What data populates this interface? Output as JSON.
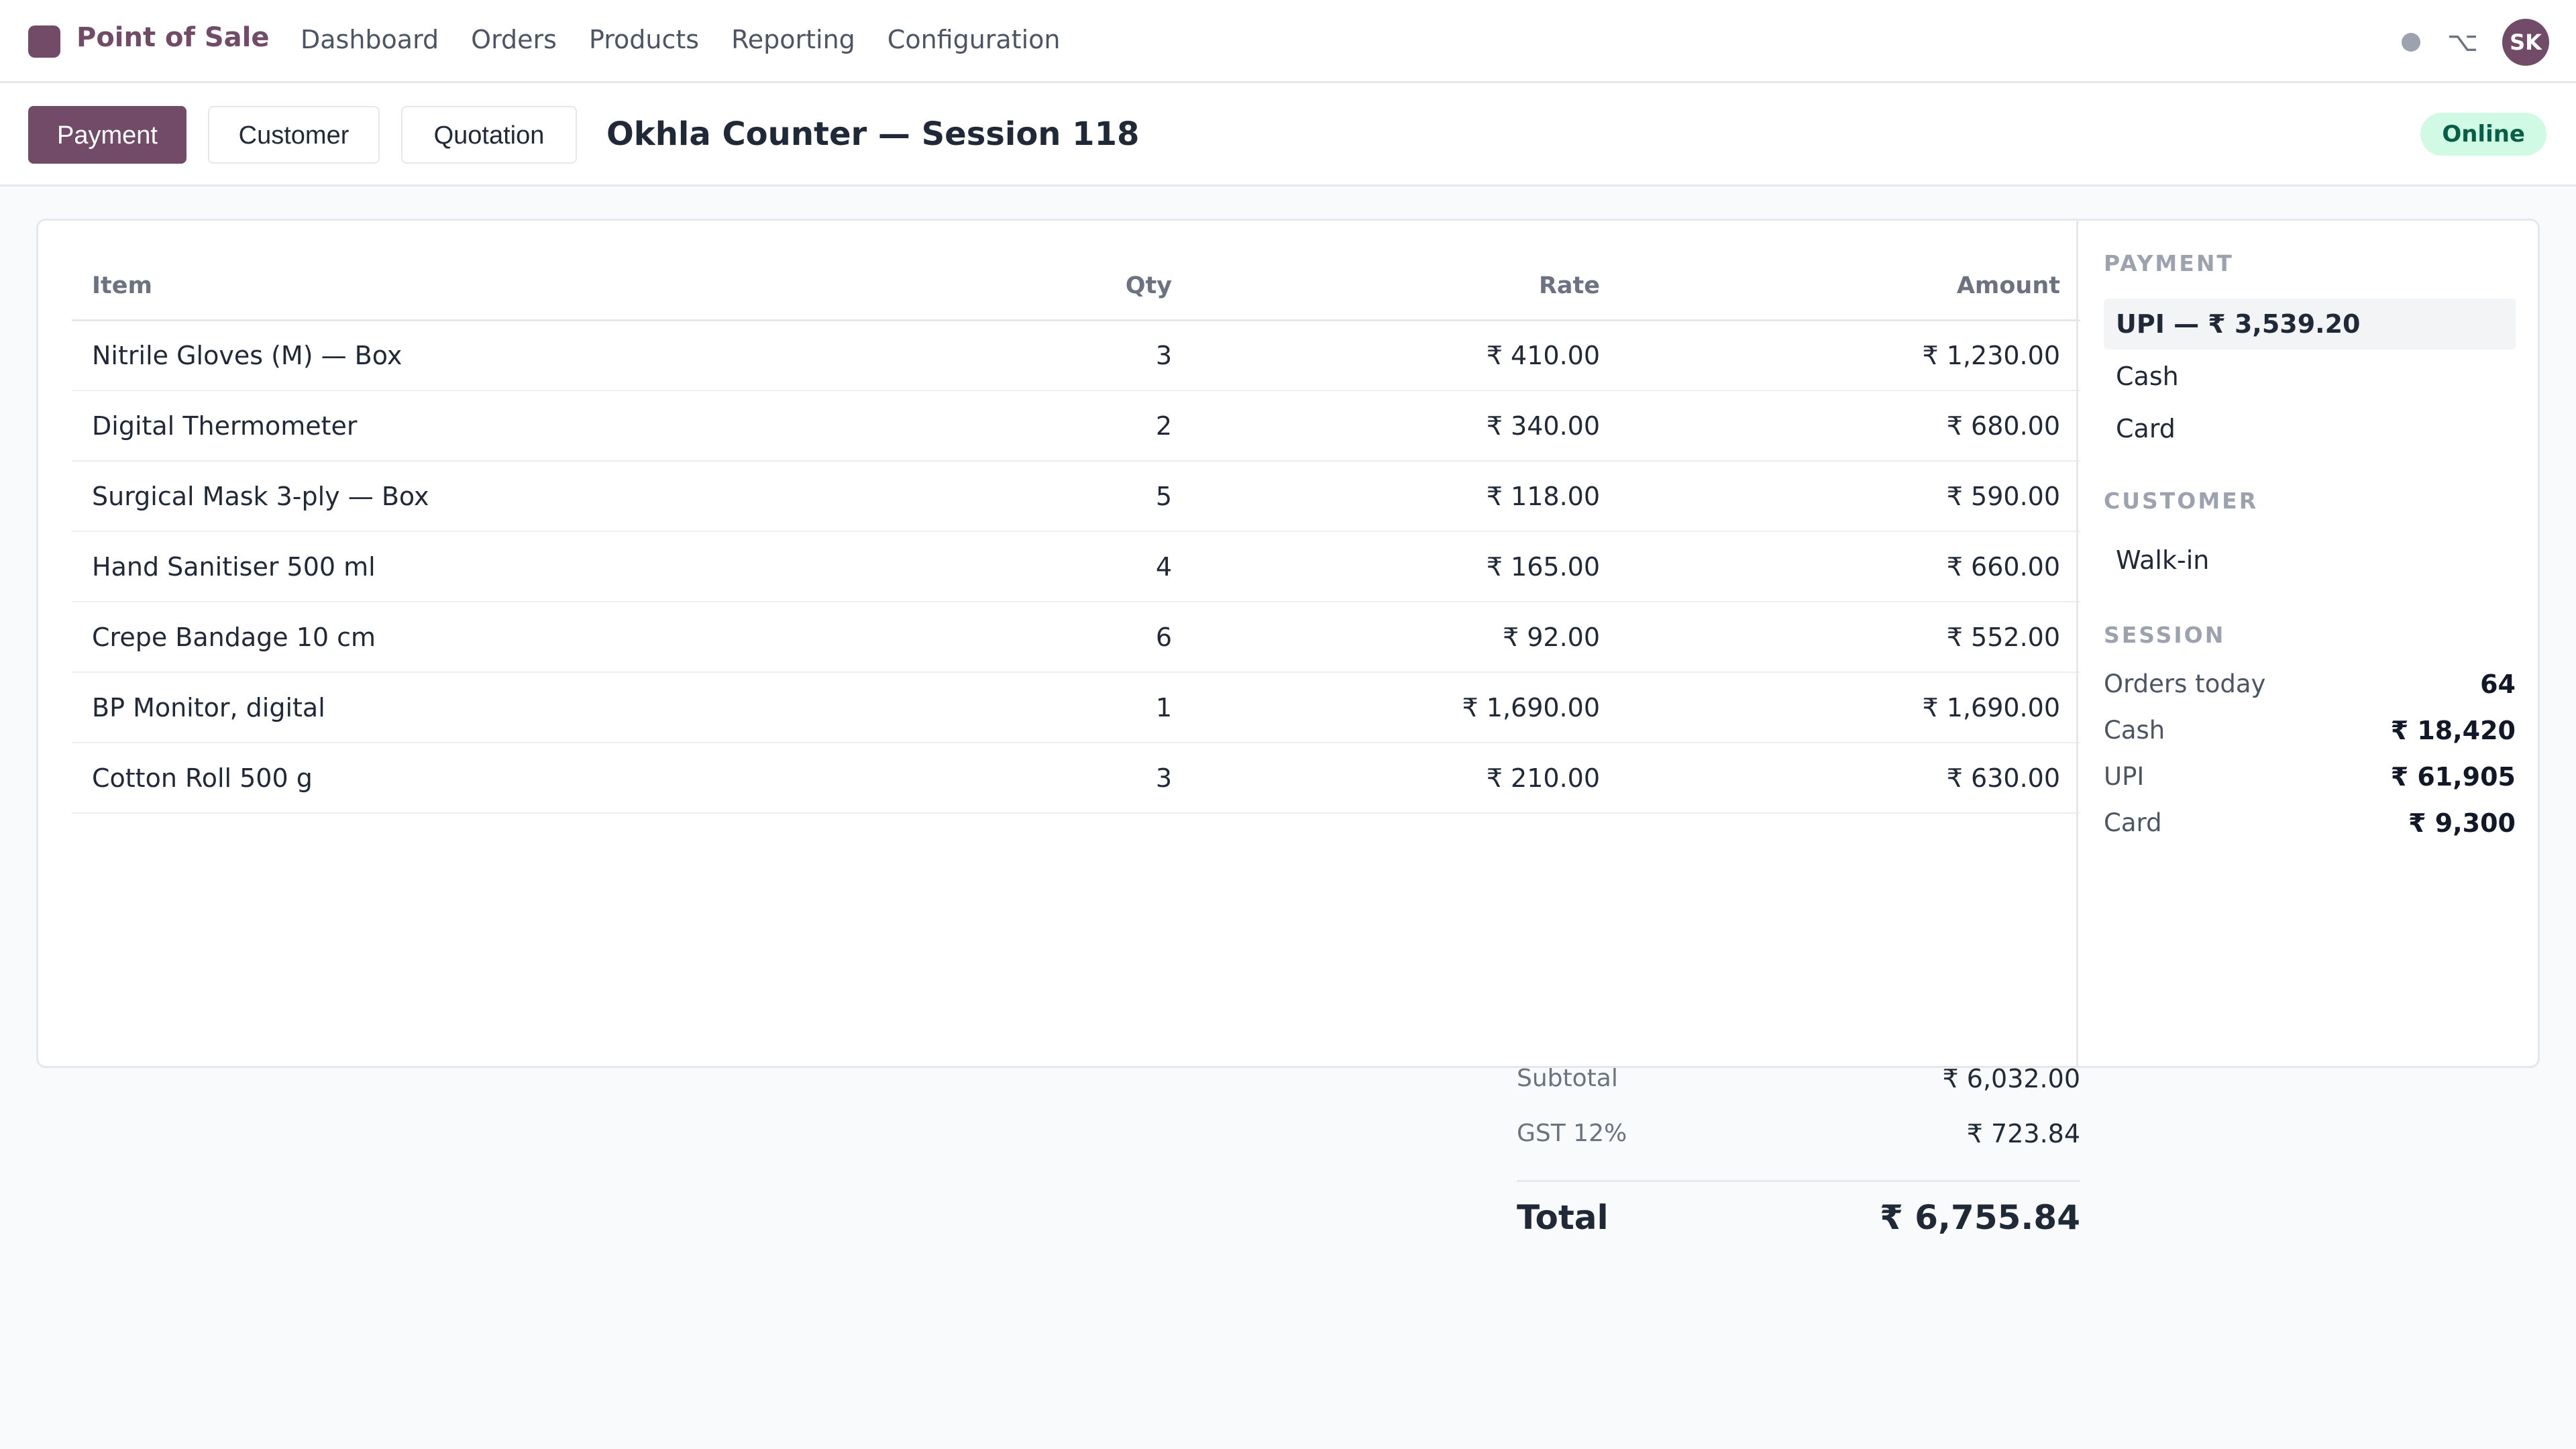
{
  "app": {
    "title": "Point of Sale",
    "accent_color": "#714b67",
    "user_initials": "SK"
  },
  "nav": {
    "items": [
      "Dashboard",
      "Orders",
      "Products",
      "Reporting",
      "Configuration"
    ]
  },
  "icons": {
    "status": "status-dot-icon",
    "shortcut": "⌥"
  },
  "toolbar": {
    "payment_label": "Payment",
    "customer_label": "Customer",
    "quotation_label": "Quotation",
    "session_title": "Okhla Counter — Session 118",
    "status_badge": "Online",
    "status_color": "#065f46"
  },
  "order": {
    "headers": {
      "item": "Item",
      "qty": "Qty",
      "rate": "Rate",
      "amount": "Amount"
    },
    "lines": [
      {
        "item": "Nitrile Gloves (M) — Box",
        "qty": "3",
        "rate": "₹ 410.00",
        "amount": "₹ 1,230.00"
      },
      {
        "item": "Digital Thermometer",
        "qty": "2",
        "rate": "₹ 340.00",
        "amount": "₹ 680.00"
      },
      {
        "item": "Surgical Mask 3-ply — Box",
        "qty": "5",
        "rate": "₹ 118.00",
        "amount": "₹ 590.00"
      },
      {
        "item": "Hand Sanitiser 500 ml",
        "qty": "4",
        "rate": "₹ 165.00",
        "amount": "₹ 660.00"
      },
      {
        "item": "Crepe Bandage 10 cm",
        "qty": "6",
        "rate": "₹ 92.00",
        "amount": "₹ 552.00"
      },
      {
        "item": "BP Monitor, digital",
        "qty": "1",
        "rate": "₹ 1,690.00",
        "amount": "₹ 1,690.00"
      },
      {
        "item": "Cotton Roll 500 g",
        "qty": "3",
        "rate": "₹ 210.00",
        "amount": "₹ 630.00"
      }
    ],
    "totals": {
      "subtotal_label": "Subtotal",
      "subtotal_value": "₹ 6,032.00",
      "gst_label": "GST 12%",
      "gst_value": "₹ 723.84",
      "total_label": "Total",
      "total_value": "₹ 6,755.84"
    }
  },
  "sidebar": {
    "payment": {
      "title": "PAYMENT",
      "options": [
        "UPI — ₹ 3,539.20",
        "Cash",
        "Card"
      ],
      "selected": "UPI — ₹ 3,539.20"
    },
    "customer": {
      "title": "CUSTOMER",
      "value": "Walk-in"
    },
    "session": {
      "title": "SESSION",
      "stats": [
        {
          "label": "Orders today",
          "value": "64"
        },
        {
          "label": "Cash",
          "value": "₹ 18,420"
        },
        {
          "label": "UPI",
          "value": "₹ 61,905"
        },
        {
          "label": "Card",
          "value": "₹ 9,300"
        }
      ]
    }
  }
}
